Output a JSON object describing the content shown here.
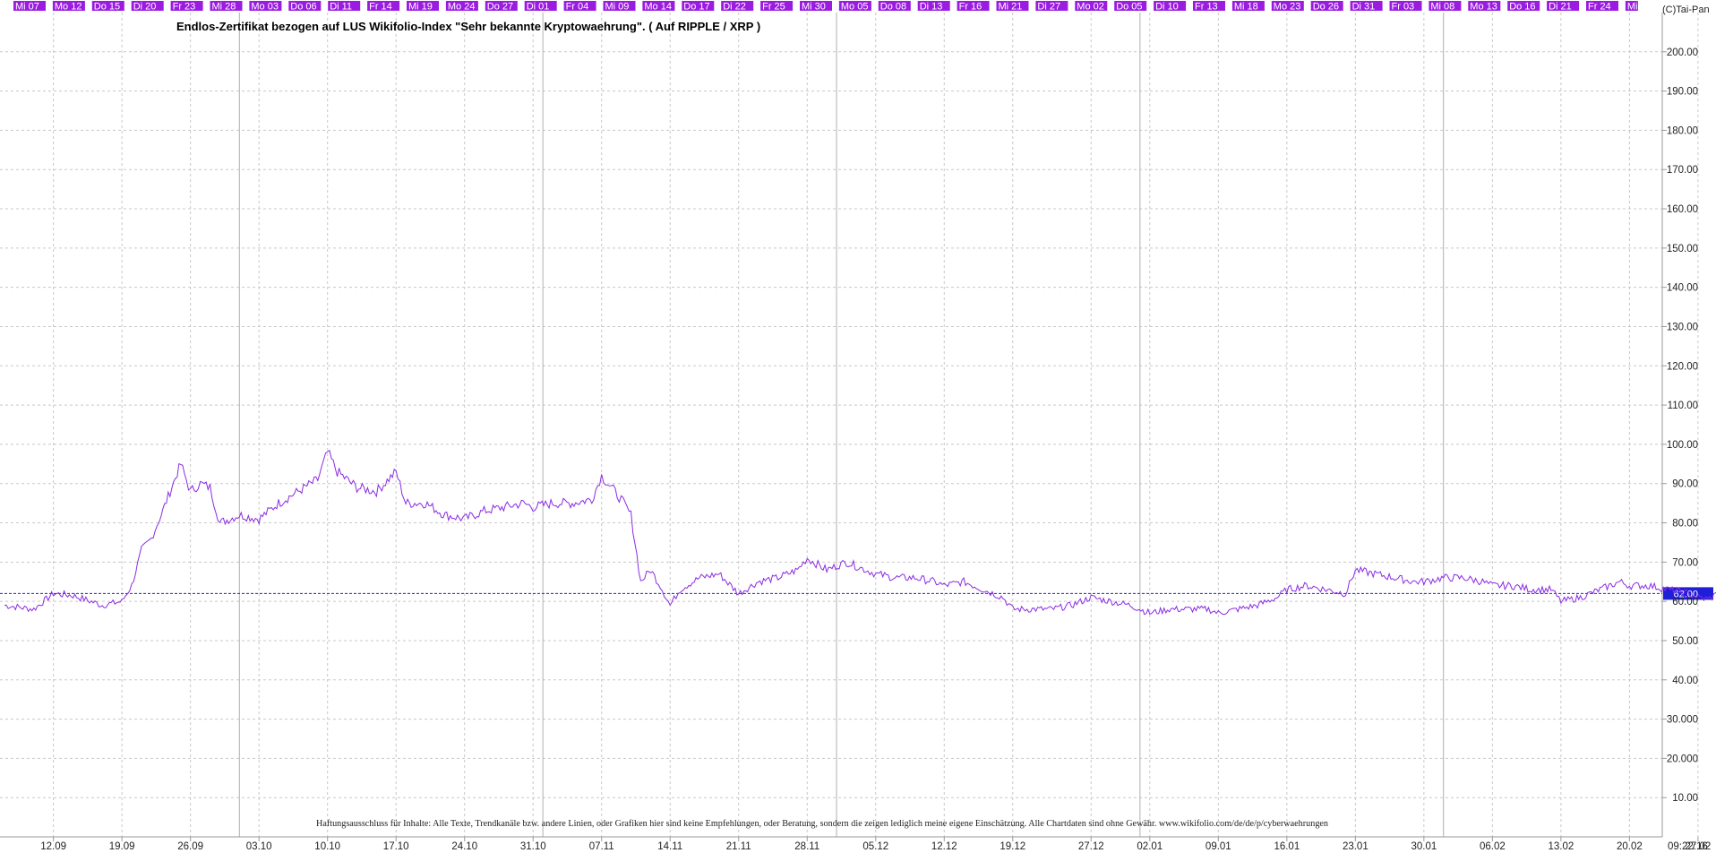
{
  "chart_data": {
    "type": "line",
    "title": "Endlos-Zertifikat bezogen auf LUS Wikifolio-Index \"Sehr bekannte Kryptowaehrung\". ( Auf RIPPLE / XRP )",
    "credit": "(C)Tai-Pan",
    "timestamp": "09:22:16",
    "disclaimer": "Haftungsausschluss für Inhalte: Alle Texte, Trendkanäle bzw. andere Linien, oder Grafiken hier sind keine Empfehlungen, oder Beratung, sondern die zeigen lediglich meine eigene Einschätzung. Alle Chartdaten sind ohne Gewähr. www.wikifolio.com/de/de/p/cyberwaehrungen",
    "ylim": [
      0,
      210
    ],
    "grid": true,
    "y_ticks": [
      "10.00",
      "20.000",
      "30.000",
      "40.00",
      "50.00",
      "60.00",
      "70.00",
      "80.00",
      "90.00",
      "100.00",
      "110.00",
      "120.00",
      "130.00",
      "140.00",
      "150.00",
      "160.00",
      "170.00",
      "180.00",
      "190.00",
      "200.00"
    ],
    "reference_line": {
      "value": 62.0,
      "label": "62.00",
      "color": "#1f1fd8"
    },
    "top_day_labels": [
      "Mi 07",
      "Mo 12",
      "Do 15",
      "Di 20",
      "Fr 23",
      "Mi 28",
      "Mo 03",
      "Do 06",
      "Di 11",
      "Fr 14",
      "Mi 19",
      "Mo 24",
      "Do 27",
      "Di 01",
      "Fr 04",
      "Mi 09",
      "Mo 14",
      "Do 17",
      "Di 22",
      "Fr 25",
      "Mi 30",
      "Mo 05",
      "Do 08",
      "Di 13",
      "Fr 16",
      "Mi 21",
      "Di 27",
      "Mo 02",
      "Do 05",
      "Di 10",
      "Fr 13",
      "Mi 18",
      "Mo 23",
      "Do 26",
      "Di 31",
      "Fr 03",
      "Mi 08",
      "Mo 13",
      "Do 16",
      "Di 21",
      "Fr 24",
      "Mi"
    ],
    "x_labels": [
      "12.09",
      "19.09",
      "26.09",
      "03.10",
      "10.10",
      "17.10",
      "24.10",
      "31.10",
      "07.11",
      "14.11",
      "21.11",
      "28.11",
      "05.12",
      "12.12",
      "19.12",
      "27.12",
      "02.01",
      "09.01",
      "16.01",
      "23.01",
      "30.01",
      "06.02",
      "13.02",
      "20.02",
      "27.02"
    ],
    "series": [
      {
        "color": "#8a2be2",
        "x": [
          "07.09",
          "10.09",
          "12.09",
          "14.09",
          "17.09",
          "19.09",
          "20.09",
          "21.09",
          "22.09",
          "23.09",
          "25.09",
          "26.09",
          "27.09",
          "28.09",
          "29.09",
          "01.10",
          "03.10",
          "05.10",
          "07.10",
          "09.10",
          "10.10",
          "11.10",
          "13.10",
          "15.10",
          "17.10",
          "18.10",
          "20.10",
          "22.10",
          "24.10",
          "26.10",
          "28.10",
          "30.10",
          "31.10",
          "02.11",
          "04.11",
          "06.11",
          "07.11",
          "08.11",
          "09.11",
          "10.11",
          "11.11",
          "12.11",
          "13.11",
          "14.11",
          "15.11",
          "17.11",
          "19.11",
          "21.11",
          "23.11",
          "25.11",
          "27.11",
          "28.11",
          "30.11",
          "02.12",
          "04.12",
          "05.12",
          "07.12",
          "09.12",
          "11.12",
          "12.12",
          "14.12",
          "16.12",
          "18.12",
          "19.12",
          "21.12",
          "23.12",
          "25.12",
          "27.12",
          "29.12",
          "31.12",
          "02.01",
          "04.01",
          "06.01",
          "08.01",
          "09.01",
          "11.01",
          "13.01",
          "15.01",
          "16.01",
          "18.01",
          "20.01",
          "22.01",
          "23.01",
          "25.01",
          "27.01",
          "29.01",
          "30.01",
          "01.02",
          "03.02",
          "05.02",
          "06.02",
          "08.02",
          "10.02",
          "12.02",
          "13.02",
          "15.02",
          "17.02",
          "19.02",
          "20.02",
          "22.02",
          "24.02",
          "26.02",
          "27.02",
          "28.02",
          "01.03"
        ],
        "values": [
          59,
          58,
          62,
          61.5,
          59,
          60,
          64,
          73,
          76,
          82,
          95,
          88,
          90,
          89,
          80,
          82,
          81,
          85,
          88,
          91,
          98,
          93,
          89,
          88,
          93,
          85,
          85,
          82,
          81,
          83,
          84,
          85,
          84,
          85,
          85,
          86,
          92,
          89,
          86,
          82,
          65,
          68,
          64,
          59,
          63,
          66,
          67,
          62,
          65,
          66,
          68,
          71,
          68,
          70,
          68,
          67,
          66,
          66,
          65,
          64,
          65,
          63,
          61,
          58,
          58,
          58,
          59,
          61,
          60,
          59,
          57,
          58,
          58,
          58,
          57,
          58,
          59,
          61,
          63,
          64,
          63,
          62,
          68,
          67,
          66,
          65,
          65,
          66,
          66,
          65,
          64,
          64,
          63,
          63,
          60,
          61,
          63,
          65,
          64,
          64,
          63,
          62,
          61,
          60.5,
          62
        ]
      }
    ]
  }
}
